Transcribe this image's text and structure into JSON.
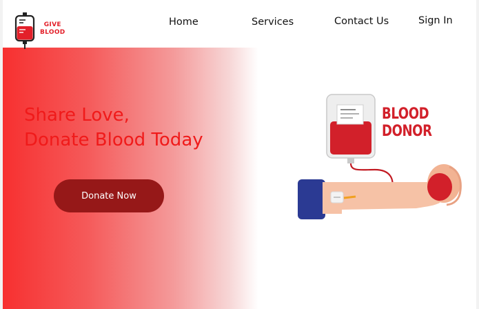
{
  "logo": {
    "line1": "GIVE",
    "line2": "BLOOD",
    "icon": "blood-bag-icon"
  },
  "nav": {
    "home": "Home",
    "services": "Services",
    "contact": "Contact Us",
    "signin": "Sign In"
  },
  "hero": {
    "headline_line1": "Share Love,",
    "headline_line2": "Donate Blood Today",
    "cta": "Donate Now"
  },
  "illustration": {
    "label_line1": "BLOOD",
    "label_line2": "DONOR",
    "icon": "blood-donation-illustration"
  },
  "colors": {
    "brand_red": "#e3202a",
    "headline_red": "#f01a1a",
    "button_dark_red": "#961818",
    "gradient_start": "#f73030"
  }
}
